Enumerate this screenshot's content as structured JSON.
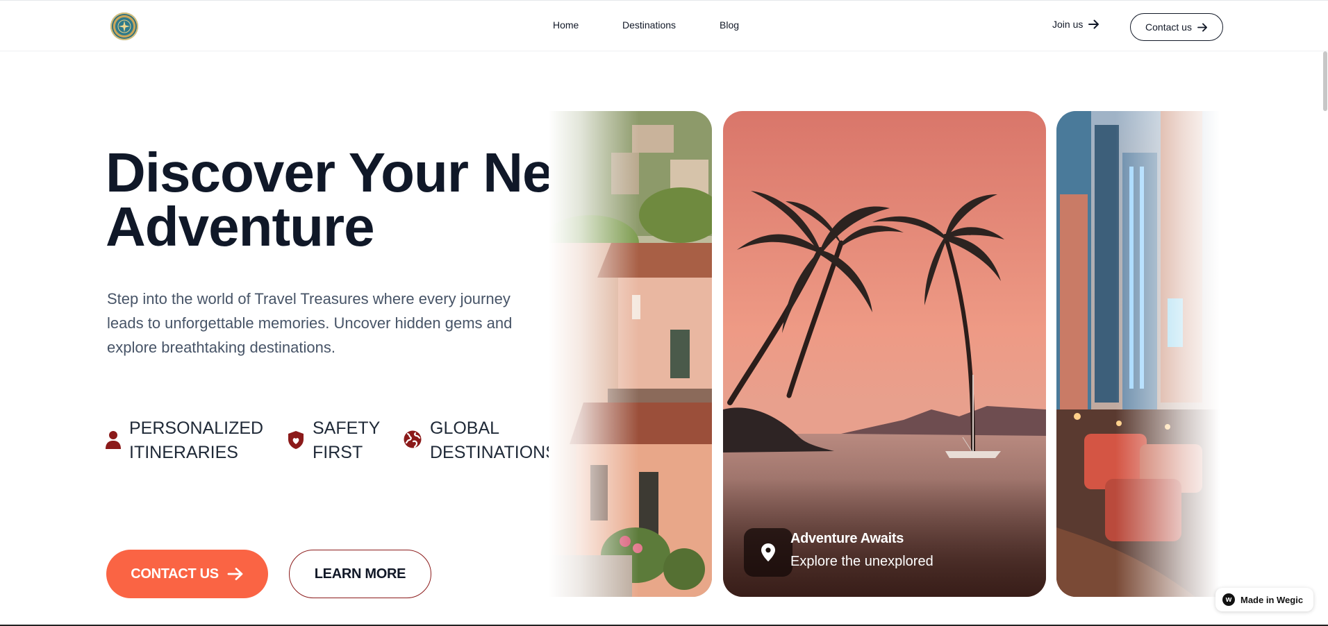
{
  "header": {
    "nav": {
      "home": "Home",
      "destinations": "Destinations",
      "blog": "Blog"
    },
    "join_label": "Join us",
    "contact_label": "Contact us"
  },
  "hero": {
    "title_line1": "Discover Your Next",
    "title_line2": "Adventure",
    "description": "Step into the world of Travel Treasures where every journey leads to unforgettable memories. Uncover hidden gems and explore breathtaking destinations.",
    "features": [
      {
        "line1": "PERSONALIZED",
        "line2": "ITINERARIES",
        "icon": "user-icon"
      },
      {
        "line1": "SAFETY",
        "line2": "FIRST",
        "icon": "shield-icon"
      },
      {
        "line1": "GLOBAL",
        "line2": "DESTINATIONS",
        "icon": "globe-icon"
      }
    ],
    "primary_button": "CONTACT US",
    "secondary_button": "LEARN MORE"
  },
  "cards": {
    "center": {
      "title": "Adventure Awaits",
      "subtitle": "Explore the unexplored",
      "icon": "map-pin-icon"
    }
  },
  "badge": {
    "label": "Made in Wegic"
  },
  "colors": {
    "accent": "#fa6444",
    "dark_red": "#8b1a1a",
    "heading": "#101828",
    "body_text": "#475467"
  }
}
